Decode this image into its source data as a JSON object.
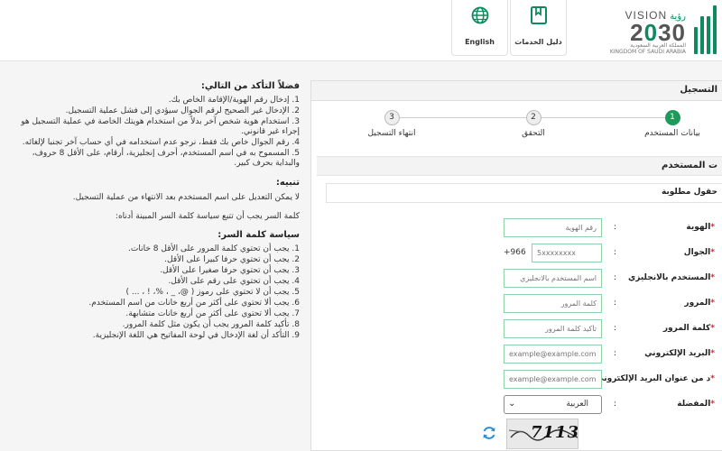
{
  "header": {
    "logo": {
      "vision": "VISION",
      "vision_ar": "رؤية",
      "year_a": "2",
      "year_b": "0",
      "year_c": "30",
      "kingdom_ar": "المملكة العربية السعودية",
      "kingdom_en": "KINGDOM OF SAUDI ARABIA"
    },
    "guide_button": {
      "label": "دليل الخدمات",
      "icon": "book-icon"
    },
    "language_button": {
      "label": "English",
      "icon": "globe-icon"
    },
    "accent_color": "#0f8a5f"
  },
  "instructions": {
    "verify_title": "فضلاً التأكد من التالي:",
    "verify_items": [
      "1. إدخال رقم الهوية/الإقامة الخاص بك.",
      "2. الإدخال غير الصحيح لرقم الجوال سيؤدي إلى فشل عملية التسجيل.",
      "3. استخدام هوية شخص آخر بدلاً من استخدام هويتك الخاصة في عملية التسجيل هو إجراء غير قانوني.",
      "4. رقم الجوال خاص بك فقط، نرجو عدم استخدامه في أي حساب آخر تجنبا لإلغائه.",
      "5. المسموح به في اسم المستخدم، أحرف إنجليزية، أرقام، على الأقل 8 حروف، والبداية بحرف كبير."
    ],
    "alert_title": "تنبيه:",
    "alert_text": "لا يمكن التعديل على اسم المستخدم بعد الانتهاء من عملية التسجيل.",
    "policy_note": "كلمة السر يجب أن تتبع سياسة كلمة السر المبينة أدناه:",
    "policy_title": "سياسة كلمة السر:",
    "policy_items": [
      "1. يجب أن تحتوي كلمة المرور على الأقل 8 خانات.",
      "2. يجب أن تحتوي حرفا كبيرا على الأقل.",
      "3. يجب أن تحتوي حرفا صغيرا على الأقل.",
      "4. يجب أن تحتوي على رقم على الأقل.",
      "5. يجب أن لا تحتوي على رموز ( @، _ ، %، ! ، ... )",
      "6. يجب ألا تحتوي على أكثر من أربع خانات من اسم المستخدم.",
      "7. يجب ألا تحتوي على أكثر من أربع خانات متشابهة.",
      "8. تأكيد كلمة المرور يجب أن يكون مثل كلمة المرور.",
      "9. التأكد أن لغة الإدخال في لوحة المفاتيح هي اللغة الإنجليزية."
    ]
  },
  "registration": {
    "title": "التسجيل",
    "steps": [
      {
        "number": "1",
        "label": "بيانات المستخدم",
        "active": true
      },
      {
        "number": "2",
        "label": "التحقق",
        "active": false
      },
      {
        "number": "3",
        "label": "انتهاء التسجيل",
        "active": false
      }
    ],
    "section_title": "ت المستخدم",
    "required_note": "حقول مطلوبة",
    "fields": {
      "id": {
        "label": "الهوية",
        "star": "*",
        "placeholder": "رقم الهوية"
      },
      "mobile": {
        "label": "الجوال",
        "star": "*",
        "prefix": "+966",
        "placeholder": "5xxxxxxxx"
      },
      "username": {
        "label": "المستخدم بالانجليزي",
        "star": "*",
        "placeholder": "اسم المستخدم بالانجليزي"
      },
      "password": {
        "label": "المرور",
        "star": "*",
        "placeholder": "كلمة المرور"
      },
      "confirm_password": {
        "label": "كلمة المرور",
        "star": "*",
        "placeholder": "تأكيد كلمة المرور"
      },
      "email": {
        "label": "البريد الإلكتروني",
        "star": "*",
        "placeholder": "example@example.com"
      },
      "confirm_email": {
        "label": "د من عنوان البريد الإلكتروني",
        "star": "*",
        "placeholder": "example@example.com"
      },
      "language": {
        "label": "المفضلة",
        "star": "*",
        "value": "العربية"
      }
    },
    "colon": ":",
    "captcha_text": "7113",
    "star_color": "#d9232e",
    "step_active_color": "#1f9a5b"
  }
}
